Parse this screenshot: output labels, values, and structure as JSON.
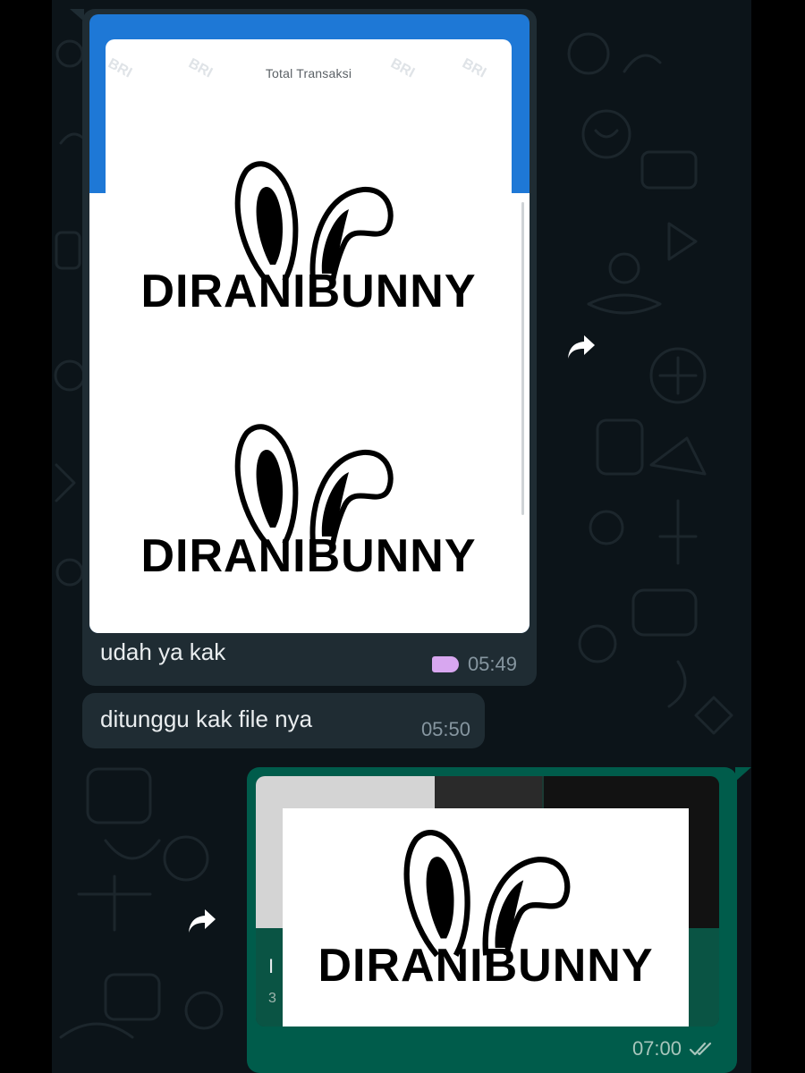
{
  "chat": {
    "messages": [
      {
        "direction": "incoming",
        "type": "image",
        "image": {
          "header_text": "Total Transaksi",
          "watermark_text": "BRI",
          "brand_text": "DIRANIBUNNY"
        },
        "caption": "udah ya kak",
        "label_color": "#d8a7f0",
        "time": "05:49"
      },
      {
        "direction": "incoming",
        "type": "text",
        "text": "ditunggu kak file nya",
        "time": "05:50"
      },
      {
        "direction": "outgoing",
        "type": "document",
        "doc_initial": "I",
        "doc_sub": "3",
        "brand_text": "DIRANIBUNNY",
        "time": "07:00",
        "status": "read"
      }
    ]
  },
  "icons": {
    "forward": "forward-arrow-icon",
    "read_receipt": "double-check-icon",
    "label": "label-tag-icon"
  },
  "colors": {
    "chat_bg": "#0c1419",
    "incoming_bubble": "#1f2c33",
    "outgoing_bubble": "#005c4b",
    "text_primary": "#e9edef",
    "text_meta": "#8696a0",
    "header_blue": "#1e78d6"
  }
}
